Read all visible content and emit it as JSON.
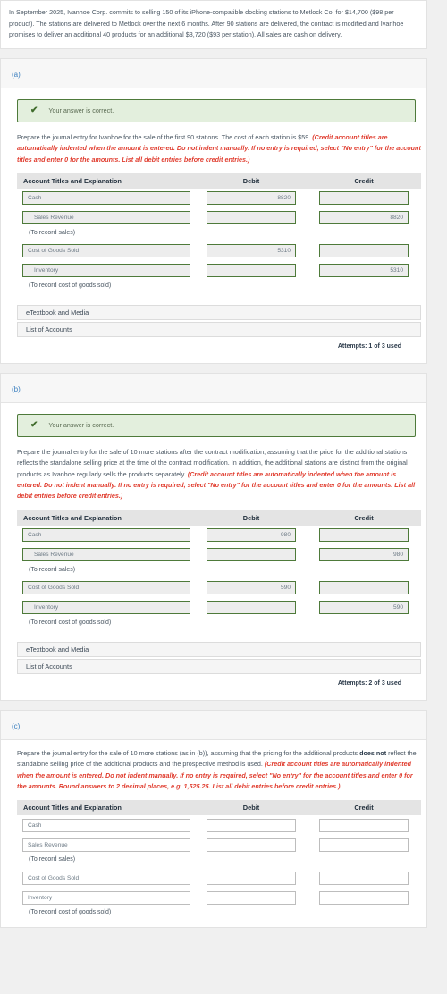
{
  "intro": {
    "text": "In September 2025, Ivanhoe Corp. commits to selling 150 of its iPhone-compatible docking stations to Metlock Co. for $14,700 ($98 per product). The stations are delivered to Metlock over the next 6 months. After 90 stations are delivered, the contract is modified and Ivanhoe promises to deliver an additional 40 products for an additional $3,720 ($93 per station). All sales are cash on delivery."
  },
  "table_headers": {
    "account": "Account Titles and Explanation",
    "debit": "Debit",
    "credit": "Credit"
  },
  "memos": {
    "sales": "(To record sales)",
    "cogs": "(To record cost of goods sold)"
  },
  "accordions": {
    "etextbook": "eTextbook and Media",
    "accounts": "List of Accounts"
  },
  "banner": {
    "icon": "check-icon",
    "text": "Your answer is correct."
  },
  "sections": [
    {
      "label": "(a)",
      "has_banner": true,
      "prompt_plain_1": "Prepare the journal entry for Ivanhoe for the sale of the first 90 stations. The cost of each station is $59. ",
      "prompt_hint": "(Credit account titles are automatically indented when the amount is entered. Do not indent manually. If no entry is required, select \"No entry\" for the account titles and enter 0 for the amounts. List all debit entries before credit entries.)",
      "filled": true,
      "rows": [
        {
          "account": "Cash",
          "indent": false,
          "debit": "8820",
          "credit": ""
        },
        {
          "account": "Sales Revenue",
          "indent": true,
          "debit": "",
          "credit": "8820"
        },
        {
          "memo": "sales"
        },
        {
          "account": "Cost of Goods Sold",
          "indent": false,
          "debit": "5310",
          "credit": ""
        },
        {
          "account": "Inventory",
          "indent": true,
          "debit": "",
          "credit": "5310"
        },
        {
          "memo": "cogs"
        }
      ],
      "attempts": "Attempts: 1 of 3 used",
      "show_accordions": true
    },
    {
      "label": "(b)",
      "has_banner": true,
      "prompt_plain_1": "Prepare the journal entry for the sale of 10 more stations after the contract modification, assuming that the price for the additional stations reflects the standalone selling price at the time of the contract modification. In addition, the additional stations are distinct from the original products as Ivanhoe regularly sells the products separately. ",
      "prompt_hint": "(Credit account titles are automatically indented when the amount is entered. Do not indent manually. If no entry is required, select \"No entry\" for the account titles and enter 0 for the amounts. List all debit entries before credit entries.)",
      "filled": true,
      "rows": [
        {
          "account": "Cash",
          "indent": false,
          "debit": "980",
          "credit": ""
        },
        {
          "account": "Sales Revenue",
          "indent": true,
          "debit": "",
          "credit": "980"
        },
        {
          "memo": "sales"
        },
        {
          "account": "Cost of Goods Sold",
          "indent": false,
          "debit": "590",
          "credit": ""
        },
        {
          "account": "Inventory",
          "indent": true,
          "debit": "",
          "credit": "590"
        },
        {
          "memo": "cogs"
        }
      ],
      "attempts": "Attempts: 2 of 3 used",
      "show_accordions": true
    },
    {
      "label": "(c)",
      "has_banner": false,
      "prompt_plain_1": "Prepare the journal entry for the sale of 10 more stations (as in (b)), assuming that the pricing for the additional products ",
      "prompt_bold": "does not",
      "prompt_plain_2": " reflect the standalone selling price of the additional products and the prospective method is used. ",
      "prompt_hint": "(Credit account titles are automatically indented when the amount is entered. Do not indent manually. If no entry is required, select \"No entry\" for the account titles and enter 0 for the amounts. Round answers to 2 decimal places, e.g. 1,525.25. List all debit entries before credit entries.)",
      "filled": false,
      "rows": [
        {
          "account": "Cash",
          "indent": false,
          "debit": "",
          "credit": ""
        },
        {
          "account": "Sales Revenue",
          "indent": false,
          "debit": "",
          "credit": ""
        },
        {
          "memo": "sales"
        },
        {
          "account": "Cost of Goods Sold",
          "indent": false,
          "debit": "",
          "credit": ""
        },
        {
          "account": "Inventory",
          "indent": false,
          "debit": "",
          "credit": ""
        },
        {
          "memo": "cogs"
        }
      ],
      "attempts": "",
      "show_accordions": false
    }
  ]
}
